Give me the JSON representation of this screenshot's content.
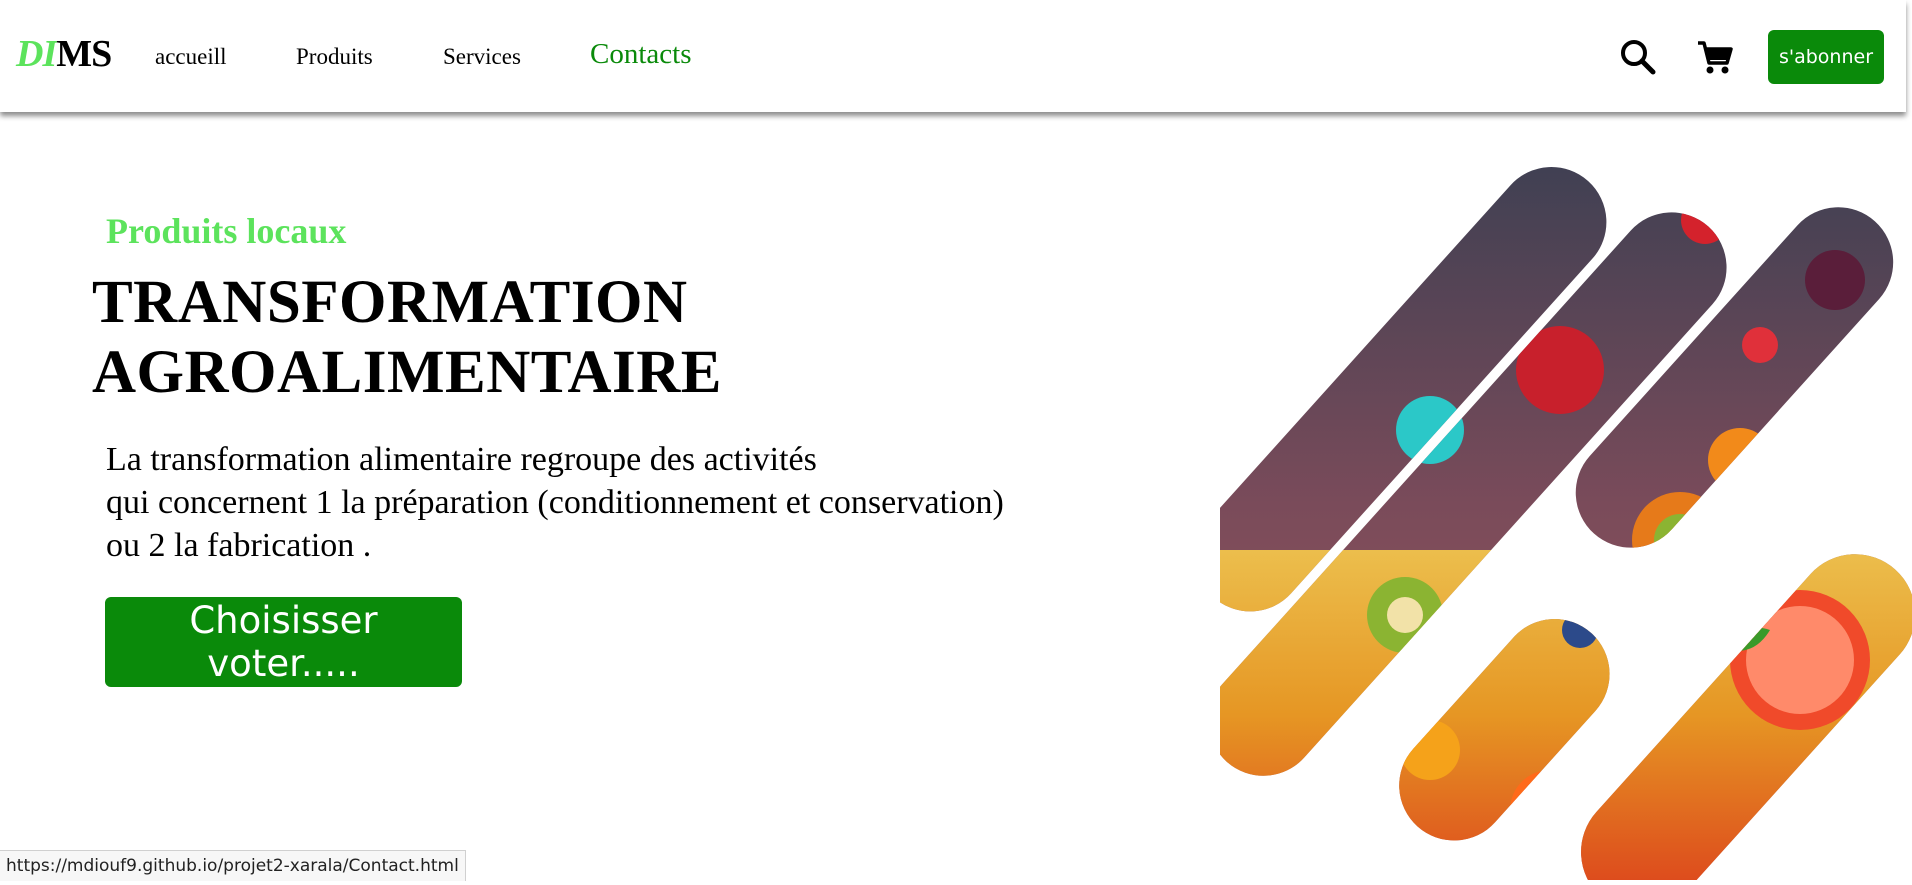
{
  "header": {
    "logo_part1": "DI",
    "logo_part2": "MS",
    "nav": [
      {
        "label": "accueill"
      },
      {
        "label": "Produits"
      },
      {
        "label": "Services"
      },
      {
        "label": "Contacts"
      }
    ],
    "search_icon": "search-icon",
    "cart_icon": "cart-icon",
    "subscribe_label": "s'abonner"
  },
  "hero": {
    "kicker": "Produits locaux",
    "title_line1": "TRANSFORMATION",
    "title_line2": "AGROALIMENTAIRE",
    "desc_line1": "La transformation alimentaire regroupe des activités",
    "desc_line2": "qui concernent 1 la préparation (conditionnement et conservation)",
    "desc_line3": "ou 2 la fabrication .",
    "cta_label": "Choisisser voter....."
  },
  "status_bar": {
    "url": "https://mdiouf9.github.io/projet2-xarala/Contact.html"
  },
  "colors": {
    "accent_green": "#0a8a0a",
    "light_green": "#5ce35c"
  }
}
